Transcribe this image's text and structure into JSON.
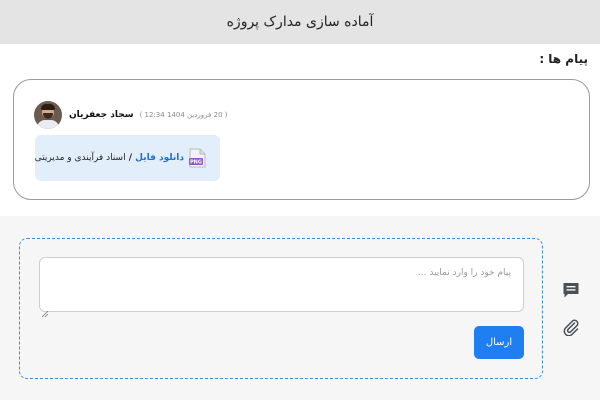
{
  "header": {
    "title": "آماده سازی مدارک پروژه"
  },
  "messages": {
    "label": "پیام ها :",
    "items": [
      {
        "author": "سجاد جعفریان",
        "timestamp": "( 20 فروردین 1404 12:34 )",
        "attachment": {
          "link_text": "دانلود فایل",
          "separator": " / ",
          "file_name": "اسناد فرآیندی و مدیریتی",
          "icon": "png-file-icon",
          "icon_label": "PNG"
        }
      }
    ]
  },
  "composer": {
    "placeholder": "پیام خود را وارد نمایید ...",
    "value": "",
    "send_label": "ارسال"
  },
  "side_icons": [
    "comment-icon",
    "paperclip-icon"
  ],
  "colors": {
    "header_bg": "#e4e4e4",
    "accent": "#1f7ef0",
    "link": "#1f6fd6",
    "file_card_bg": "#e3eefb",
    "dashed_border": "#3b8be0"
  }
}
